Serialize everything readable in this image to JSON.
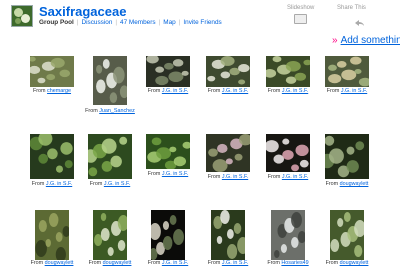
{
  "group": {
    "name": "Saxifragaceae",
    "nav": [
      {
        "label": "Group Pool",
        "current": true
      },
      {
        "label": "Discussion",
        "current": false
      },
      {
        "label": "47 Members",
        "current": false
      },
      {
        "label": "Map",
        "current": false
      },
      {
        "label": "Invite Friends",
        "current": false
      }
    ]
  },
  "toolbar": {
    "slideshow": "Slideshow",
    "share": "Share This"
  },
  "add_link": {
    "arrow": "»",
    "label": "Add something"
  },
  "caption_prefix": "From",
  "photos": [
    {
      "owner": "chemarge",
      "colors": [
        "#6f7a4a",
        "#dfe2cf",
        "#9aa86c"
      ],
      "icon": "plant-photo-icon"
    },
    {
      "owner": "Juan_Sanchez",
      "colors": [
        "#575c4a",
        "#f2f4ee",
        "#8c9479"
      ],
      "icon": "flower-photo-icon"
    },
    {
      "owner": "J.G. in S.F.",
      "colors": [
        "#2a2f24",
        "#7e8a6a",
        "#c5c9b4"
      ],
      "icon": "leaf-photo-icon"
    },
    {
      "owner": "J.G. in S.F.",
      "colors": [
        "#3e4a2f",
        "#a3b07f",
        "#e7e9d9"
      ],
      "icon": "leaf-photo-icon"
    },
    {
      "owner": "J.G. in S.F.",
      "colors": [
        "#3a4a27",
        "#8aa354",
        "#c7d3a0"
      ],
      "icon": "leaf-photo-icon"
    },
    {
      "owner": "J.G. in S.F.",
      "colors": [
        "#4f5a3c",
        "#a8b883",
        "#d9d0a2"
      ],
      "icon": "plant-photo-icon"
    },
    {
      "owner": "J.G. in S.F.",
      "colors": [
        "#263a1d",
        "#5f8a38",
        "#9cc06c"
      ],
      "icon": "leaf-photo-icon"
    },
    {
      "owner": "J.G. in S.F.",
      "colors": [
        "#2d4a1f",
        "#7aa648",
        "#b9d58d"
      ],
      "icon": "leaf-photo-icon"
    },
    {
      "owner": "J.G. in S.F.",
      "colors": [
        "#2c4f1c",
        "#6e9e3e",
        "#a9cf74"
      ],
      "icon": "leaf-photo-icon"
    },
    {
      "owner": "J.G. in S.F.",
      "colors": [
        "#2f3424",
        "#d8b9c3",
        "#9aa076"
      ],
      "icon": "flower-photo-icon"
    },
    {
      "owner": "J.G. in S.F.",
      "colors": [
        "#171612",
        "#e0a7b5",
        "#f5eef0"
      ],
      "icon": "flower-photo-icon"
    },
    {
      "owner": "dougwaylett",
      "colors": [
        "#1f2a16",
        "#6e8a52",
        "#a6b58a"
      ],
      "icon": "plant-photo-icon"
    },
    {
      "owner": "dougwaylett",
      "colors": [
        "#5c6a34",
        "#2f3a1c",
        "#9aa560"
      ],
      "icon": "plant-photo-icon"
    },
    {
      "owner": "dougwaylett",
      "colors": [
        "#3c5a24",
        "#8fb05e",
        "#dfe7cd"
      ],
      "icon": "flower-photo-icon"
    },
    {
      "owner": "J.G. in S.F.",
      "colors": [
        "#0b0b09",
        "#dcd7c8",
        "#6a7a52"
      ],
      "icon": "flower-photo-icon"
    },
    {
      "owner": "J.G. in S.F.",
      "colors": [
        "#2a3a1c",
        "#f2f3ec",
        "#98a872"
      ],
      "icon": "flower-photo-icon"
    },
    {
      "owner": "Hosaries49",
      "colors": [
        "#6c6f6a",
        "#e8ebea",
        "#3e423d"
      ],
      "icon": "rosette-photo-icon"
    },
    {
      "owner": "dougwaylett",
      "colors": [
        "#455a2c",
        "#a8bf7d",
        "#d4dec0"
      ],
      "icon": "leaf-photo-icon"
    }
  ]
}
